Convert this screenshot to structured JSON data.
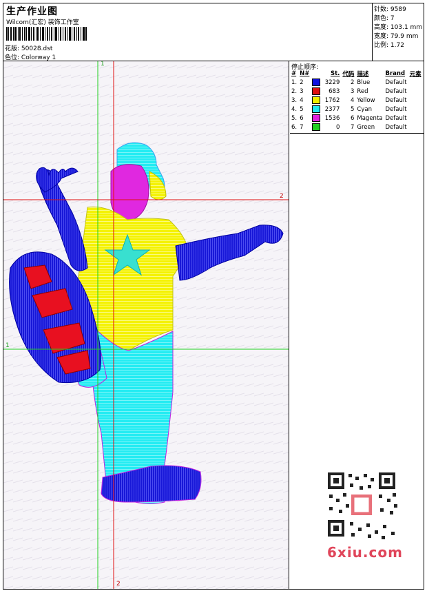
{
  "header": {
    "title": "生产作业图",
    "company": "Wilcom(汇宏) 装饰工作室",
    "design_label": "花版:",
    "design_value": "50028.dst",
    "colorway_label": "色位:",
    "colorway_value": "Colorway 1"
  },
  "stats": [
    {
      "label": "针数:",
      "value": "9589"
    },
    {
      "label": "颜色:",
      "value": "7"
    },
    {
      "label": "高度:",
      "value": "103.1 mm"
    },
    {
      "label": "宽度:",
      "value": "79.9 mm"
    },
    {
      "label": "比例:",
      "value": "1.72"
    }
  ],
  "stop_sequence": {
    "title": "停止顺序:",
    "columns": [
      "#",
      "N#",
      "St.",
      "代码",
      "描述",
      "Brand",
      "元素"
    ],
    "rows": [
      {
        "num": "1.",
        "n": "2",
        "color": "#1010e0",
        "st": "3229",
        "code": "2",
        "desc": "Blue",
        "brand": "Default"
      },
      {
        "num": "2.",
        "n": "3",
        "color": "#e01010",
        "st": "683",
        "code": "3",
        "desc": "Red",
        "brand": "Default"
      },
      {
        "num": "3.",
        "n": "4",
        "color": "#f0f000",
        "st": "1762",
        "code": "4",
        "desc": "Yellow",
        "brand": "Default"
      },
      {
        "num": "4.",
        "n": "5",
        "color": "#20e8f0",
        "st": "2377",
        "code": "5",
        "desc": "Cyan",
        "brand": "Default"
      },
      {
        "num": "5.",
        "n": "6",
        "color": "#e020e0",
        "st": "1536",
        "code": "6",
        "desc": "Magenta",
        "brand": "Default"
      },
      {
        "num": "6.",
        "n": "7",
        "color": "#20d020",
        "st": "0",
        "code": "7",
        "desc": "Green",
        "brand": "Default"
      }
    ]
  },
  "axis_labels": {
    "v1": "1",
    "v2": "2",
    "h1": "1",
    "h2": "2"
  },
  "watermark": "6xiu.com",
  "colors": {
    "blue": "#1010e0",
    "red": "#e01010",
    "yellow": "#f0f000",
    "cyan": "#20e8f0",
    "magenta": "#e020e0",
    "green": "#20d020"
  }
}
